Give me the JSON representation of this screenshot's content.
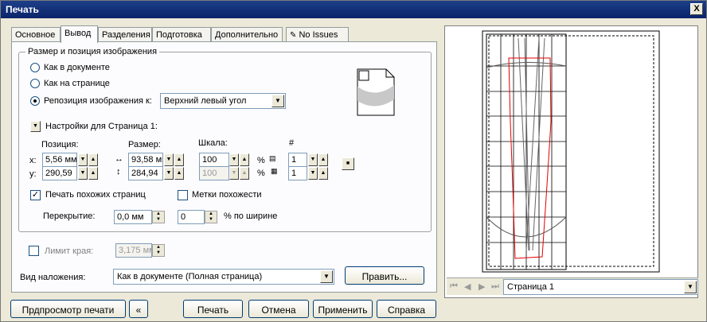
{
  "window": {
    "title": "Печать",
    "close": "X"
  },
  "tabs": [
    "Основное",
    "Вывод",
    "Разделения",
    "Подготовка",
    "Дополнительно",
    "No Issues"
  ],
  "size_position": {
    "group_title": "Размер и позиция изображения",
    "options": [
      "Как в документе",
      "Как на странице",
      "Репозиция изображения к:"
    ],
    "reposition_value": "Верхний левый угол",
    "settings_label": "Настройки для Страница 1:"
  },
  "fields": {
    "position_label": "Позиция:",
    "size_label": "Размер:",
    "scale_label": "Шкала:",
    "hash_label": "#",
    "x_label": "x:",
    "y_label": "y:",
    "x_value": "5,56 мм",
    "y_value": "290,59",
    "width_value": "93,58 мм",
    "height_value": "284,94",
    "scale_x": "100",
    "scale_y": "100",
    "percent": "%",
    "tile_x": "1",
    "tile_y": "1"
  },
  "tiling": {
    "print_tiles_label": "Печать похожих страниц",
    "tile_marks_label": "Метки похожести",
    "overlap_label": "Перекрытие:",
    "overlap_value": "0,0 мм",
    "overlap_pct_value": "0",
    "overlap_pct_label": "% по ширине"
  },
  "bleed": {
    "label": "Лимит края:",
    "value": "3,175 мм"
  },
  "imposition": {
    "label": "Вид наложения:",
    "value": "Как в документе (Полная страница)",
    "edit_button": "Править..."
  },
  "footer": {
    "preview": "Прдпросмотр печати",
    "print": "Печать",
    "cancel": "Отмена",
    "apply": "Применить",
    "help": "Справка"
  },
  "preview_nav": {
    "page_value": "Страница 1"
  }
}
